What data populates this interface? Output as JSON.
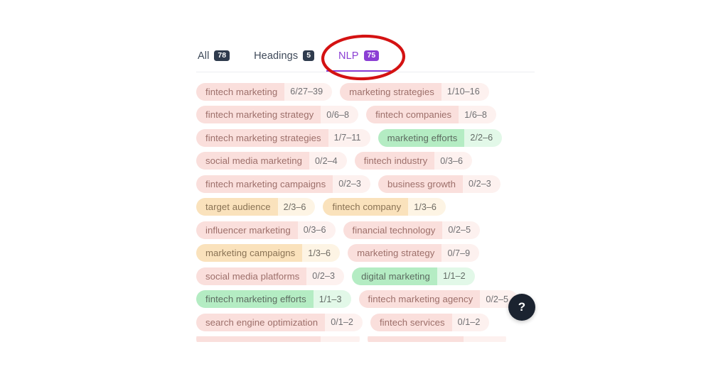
{
  "tabs": [
    {
      "label": "All",
      "badge": "78",
      "active": false
    },
    {
      "label": "Headings",
      "badge": "5",
      "active": false
    },
    {
      "label": "NLP",
      "badge": "75",
      "active": true
    }
  ],
  "help": {
    "icon": "question-mark-icon",
    "label": "?"
  },
  "annotation": {
    "shape": "ellipse",
    "color": "#d41212",
    "target": "NLP tab"
  },
  "colors": {
    "accent_purple": "#8b3fd4",
    "badge_dark": "#2f3b4d",
    "pink_label": "#fadfdc",
    "pink_count": "#fdf1ef",
    "green_label": "#b4ecc3",
    "green_count": "#e2f8e8",
    "amber_label": "#fae2bc",
    "amber_count": "#fdf4e4",
    "help_bg": "#1b2330"
  },
  "tag_rows": [
    [
      {
        "term": "fintech marketing",
        "count": "6/27–39",
        "tone": "pink"
      },
      {
        "term": "marketing strategies",
        "count": "1/10–16",
        "tone": "pink"
      }
    ],
    [
      {
        "term": "fintech marketing strategy",
        "count": "0/6–8",
        "tone": "pink"
      },
      {
        "term": "fintech companies",
        "count": "1/6–8",
        "tone": "pink"
      }
    ],
    [
      {
        "term": "fintech marketing strategies",
        "count": "1/7–11",
        "tone": "pink"
      },
      {
        "term": "marketing efforts",
        "count": "2/2–6",
        "tone": "green"
      }
    ],
    [
      {
        "term": "social media marketing",
        "count": "0/2–4",
        "tone": "pink"
      },
      {
        "term": "fintech industry",
        "count": "0/3–6",
        "tone": "pink"
      }
    ],
    [
      {
        "term": "fintech marketing campaigns",
        "count": "0/2–3",
        "tone": "pink"
      },
      {
        "term": "business growth",
        "count": "0/2–3",
        "tone": "pink"
      }
    ],
    [
      {
        "term": "target audience",
        "count": "2/3–6",
        "tone": "amber"
      },
      {
        "term": "fintech company",
        "count": "1/3–6",
        "tone": "amber"
      }
    ],
    [
      {
        "term": "influencer marketing",
        "count": "0/3–6",
        "tone": "pink"
      },
      {
        "term": "financial technology",
        "count": "0/2–5",
        "tone": "pink"
      }
    ],
    [
      {
        "term": "marketing campaigns",
        "count": "1/3–6",
        "tone": "amber"
      },
      {
        "term": "marketing strategy",
        "count": "0/7–9",
        "tone": "pink"
      }
    ],
    [
      {
        "term": "social media platforms",
        "count": "0/2–3",
        "tone": "pink"
      },
      {
        "term": "digital marketing",
        "count": "1/1–2",
        "tone": "green"
      }
    ],
    [
      {
        "term": "fintech marketing efforts",
        "count": "1/1–3",
        "tone": "green"
      },
      {
        "term": "fintech marketing agency",
        "count": "0/2–5",
        "tone": "pink"
      }
    ],
    [
      {
        "term": "search engine optimization",
        "count": "0/1–2",
        "tone": "pink"
      },
      {
        "term": "fintech services",
        "count": "0/1–2",
        "tone": "pink"
      }
    ]
  ],
  "clipped_row": [
    {
      "term": "",
      "count": "",
      "tone": "pink"
    },
    {
      "term": "",
      "count": "",
      "tone": "pink"
    }
  ]
}
